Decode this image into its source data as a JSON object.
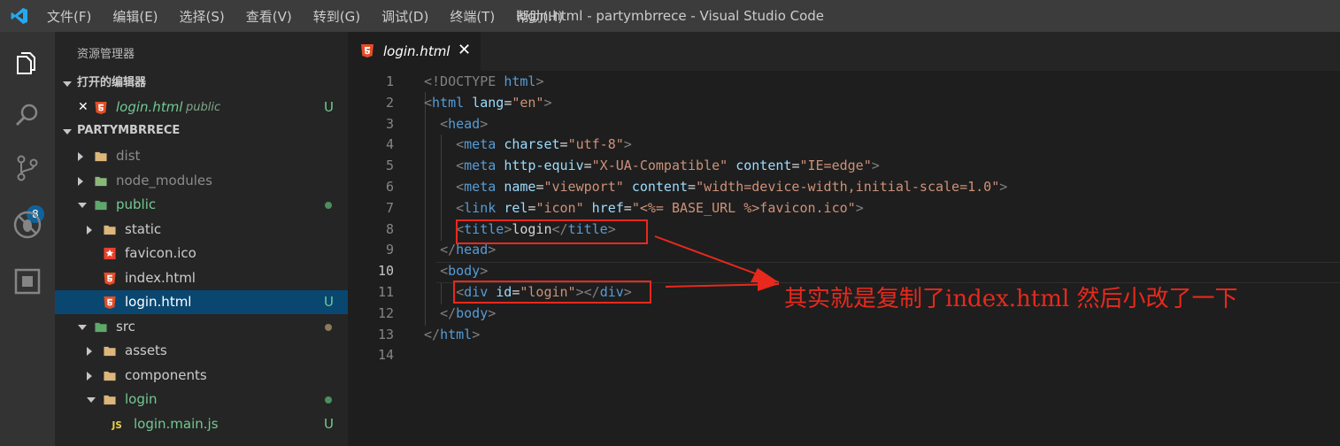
{
  "window": {
    "title": "login.html - partymbrrece - Visual Studio Code",
    "menu": [
      "文件(F)",
      "编辑(E)",
      "选择(S)",
      "查看(V)",
      "转到(G)",
      "调试(D)",
      "终端(T)",
      "帮助(H)"
    ]
  },
  "activity": {
    "scm_badge": "8"
  },
  "explorer": {
    "title": "资源管理器",
    "open_editors_label": "打开的编辑器",
    "open_editor": {
      "close": "✕",
      "name": "login.html",
      "folder": "public",
      "status": "U"
    },
    "project_label": "PARTYMBRRECE",
    "tree": [
      {
        "name": "dist",
        "type": "folder",
        "expanded": false,
        "color": "#8c8c8c"
      },
      {
        "name": "node_modules",
        "type": "folder",
        "expanded": false,
        "color": "#8c8c8c"
      },
      {
        "name": "public",
        "type": "folder",
        "expanded": true,
        "color": "#73c991",
        "dot": "#4b8f5c"
      },
      {
        "name": "static",
        "type": "folder",
        "expanded": false,
        "color": "#cccccc"
      },
      {
        "name": "favicon.ico",
        "type": "file",
        "icon": "star",
        "color": "#cccccc"
      },
      {
        "name": "index.html",
        "type": "file",
        "icon": "html5",
        "color": "#cccccc"
      },
      {
        "name": "login.html",
        "type": "file",
        "icon": "html5",
        "color": "#ffffff",
        "status": "U",
        "selected": true
      },
      {
        "name": "src",
        "type": "folder",
        "expanded": true,
        "color": "#cccccc",
        "dot": "#8c7a56"
      },
      {
        "name": "assets",
        "type": "folder",
        "expanded": false,
        "color": "#cccccc"
      },
      {
        "name": "components",
        "type": "folder",
        "expanded": false,
        "color": "#cccccc"
      },
      {
        "name": "login",
        "type": "folder",
        "expanded": true,
        "color": "#73c991",
        "dot": "#4b8f5c"
      },
      {
        "name": "login.main.js",
        "type": "file",
        "icon": "js",
        "color": "#73c991",
        "status": "U"
      }
    ]
  },
  "tab": {
    "label": "login.html",
    "close": "✕"
  },
  "editor": {
    "active_line": 10,
    "lines": [
      [
        [
          "t-br",
          "<!DOCTYPE "
        ],
        [
          "t-tag",
          "html"
        ],
        [
          "t-br",
          ">"
        ]
      ],
      [
        [
          "t-br",
          "<"
        ],
        [
          "t-tag",
          "html"
        ],
        [
          "t-txt",
          " "
        ],
        [
          "t-attr",
          "lang"
        ],
        [
          "t-txt",
          "="
        ],
        [
          "t-str",
          "\"en\""
        ],
        [
          "t-br",
          ">"
        ]
      ],
      [
        [
          "t-txt",
          "  "
        ],
        [
          "t-br",
          "<"
        ],
        [
          "t-tag",
          "head"
        ],
        [
          "t-br",
          ">"
        ]
      ],
      [
        [
          "t-txt",
          "    "
        ],
        [
          "t-br",
          "<"
        ],
        [
          "t-tag",
          "meta"
        ],
        [
          "t-txt",
          " "
        ],
        [
          "t-attr",
          "charset"
        ],
        [
          "t-txt",
          "="
        ],
        [
          "t-str",
          "\"utf-8\""
        ],
        [
          "t-br",
          ">"
        ]
      ],
      [
        [
          "t-txt",
          "    "
        ],
        [
          "t-br",
          "<"
        ],
        [
          "t-tag",
          "meta"
        ],
        [
          "t-txt",
          " "
        ],
        [
          "t-attr",
          "http-equiv"
        ],
        [
          "t-txt",
          "="
        ],
        [
          "t-str",
          "\"X-UA-Compatible\""
        ],
        [
          "t-txt",
          " "
        ],
        [
          "t-attr",
          "content"
        ],
        [
          "t-txt",
          "="
        ],
        [
          "t-str",
          "\"IE=edge\""
        ],
        [
          "t-br",
          ">"
        ]
      ],
      [
        [
          "t-txt",
          "    "
        ],
        [
          "t-br",
          "<"
        ],
        [
          "t-tag",
          "meta"
        ],
        [
          "t-txt",
          " "
        ],
        [
          "t-attr",
          "name"
        ],
        [
          "t-txt",
          "="
        ],
        [
          "t-str",
          "\"viewport\""
        ],
        [
          "t-txt",
          " "
        ],
        [
          "t-attr",
          "content"
        ],
        [
          "t-txt",
          "="
        ],
        [
          "t-str",
          "\"width=device-width,initial-scale=1.0\""
        ],
        [
          "t-br",
          ">"
        ]
      ],
      [
        [
          "t-txt",
          "    "
        ],
        [
          "t-br",
          "<"
        ],
        [
          "t-tag",
          "link"
        ],
        [
          "t-txt",
          " "
        ],
        [
          "t-attr",
          "rel"
        ],
        [
          "t-txt",
          "="
        ],
        [
          "t-str",
          "\"icon\""
        ],
        [
          "t-txt",
          " "
        ],
        [
          "t-attr",
          "href"
        ],
        [
          "t-txt",
          "="
        ],
        [
          "t-str",
          "\"<%= BASE_URL %>favicon.ico\""
        ],
        [
          "t-br",
          ">"
        ]
      ],
      [
        [
          "t-txt",
          "    "
        ],
        [
          "t-br",
          "<"
        ],
        [
          "t-tag",
          "title"
        ],
        [
          "t-br",
          ">"
        ],
        [
          "t-txt",
          "login"
        ],
        [
          "t-br",
          "</"
        ],
        [
          "t-tag",
          "title"
        ],
        [
          "t-br",
          ">"
        ]
      ],
      [
        [
          "t-txt",
          "  "
        ],
        [
          "t-br",
          "</"
        ],
        [
          "t-tag",
          "head"
        ],
        [
          "t-br",
          ">"
        ]
      ],
      [
        [
          "t-txt",
          "  "
        ],
        [
          "t-br",
          "<"
        ],
        [
          "t-tag",
          "body"
        ],
        [
          "t-br",
          ">"
        ]
      ],
      [
        [
          "t-txt",
          "    "
        ],
        [
          "t-br",
          "<"
        ],
        [
          "t-tag",
          "div"
        ],
        [
          "t-txt",
          " "
        ],
        [
          "t-attr",
          "id"
        ],
        [
          "t-txt",
          "="
        ],
        [
          "t-str",
          "\"login\""
        ],
        [
          "t-br",
          "></"
        ],
        [
          "t-tag",
          "div"
        ],
        [
          "t-br",
          ">"
        ]
      ],
      [
        [
          "t-txt",
          "  "
        ],
        [
          "t-br",
          "</"
        ],
        [
          "t-tag",
          "body"
        ],
        [
          "t-br",
          ">"
        ]
      ],
      [
        [
          "t-br",
          "</"
        ],
        [
          "t-tag",
          "html"
        ],
        [
          "t-br",
          ">"
        ]
      ],
      []
    ]
  },
  "annotation": {
    "text": "其实就是复制了index.html 然后小改了一下",
    "color": "#e8291c"
  }
}
